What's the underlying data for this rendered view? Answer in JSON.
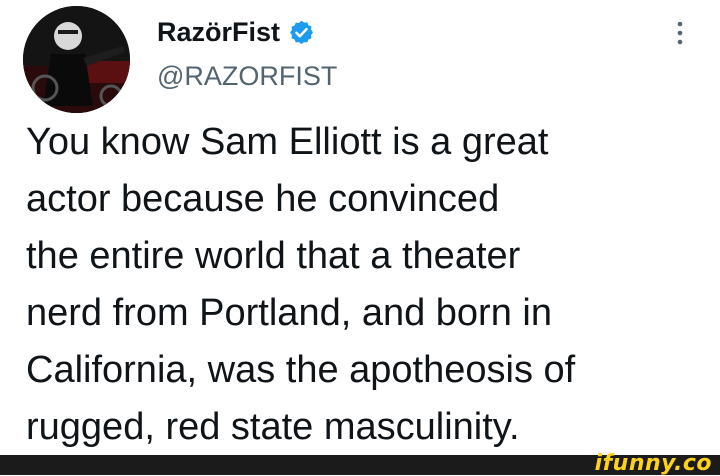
{
  "tweet": {
    "author": {
      "display_name": "RazörFist",
      "handle": "@RAZORFIST",
      "verified": true
    },
    "text_lines": [
      "You know Sam Elliott is a great",
      "actor because he convinced",
      "the entire world that a theater",
      "nerd from Portland, and born in",
      "California, was the apotheosis of",
      "rugged, red state masculinity."
    ]
  },
  "watermark": {
    "text": "ifunny.co"
  },
  "icons": {
    "verified": "verified-badge-icon",
    "more": "more-options-icon"
  },
  "colors": {
    "text_primary": "#0f1419",
    "text_secondary": "#536471",
    "verified_blue": "#1d9bf0",
    "watermark_yellow": "#ffd21a"
  }
}
